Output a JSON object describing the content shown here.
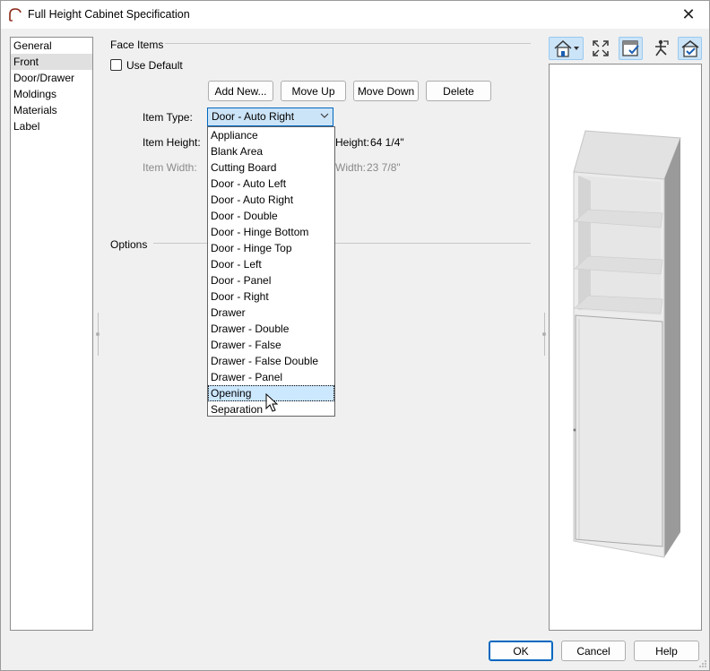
{
  "window": {
    "title": "Full Height Cabinet Specification",
    "close_glyph": "✕"
  },
  "nav": {
    "items": [
      {
        "label": "General",
        "selected": false
      },
      {
        "label": "Front",
        "selected": true
      },
      {
        "label": "Door/Drawer",
        "selected": false
      },
      {
        "label": "Moldings",
        "selected": false
      },
      {
        "label": "Materials",
        "selected": false
      },
      {
        "label": "Label",
        "selected": false
      }
    ]
  },
  "face_items": {
    "group_label": "Face Items",
    "use_default_label": "Use Default",
    "use_default_checked": false,
    "buttons": {
      "add_new": "Add New...",
      "move_up": "Move Up",
      "move_down": "Move Down",
      "delete": "Delete"
    },
    "item_type_label": "Item Type:",
    "item_type_value": "Door - Auto Right",
    "item_height_label": "Item Height:",
    "height_value_label": "Height:",
    "height_value": "64 1/4\"",
    "item_width_label": "Item Width:",
    "width_value_label": "Width:",
    "width_value": "23 7/8\""
  },
  "item_type_options": [
    "Appliance",
    "Blank Area",
    "Cutting Board",
    "Door - Auto Left",
    "Door - Auto Right",
    "Door - Double",
    "Door - Hinge Bottom",
    "Door - Hinge Top",
    "Door - Left",
    "Door - Panel",
    "Door - Right",
    "Drawer",
    "Drawer - Double",
    "Drawer - False",
    "Drawer - False Double",
    "Drawer - Panel",
    "Opening",
    "Separation"
  ],
  "highlighted_option": "Opening",
  "options_group": {
    "label": "Options"
  },
  "preview_toolbar": {
    "icons": [
      "view-type-icon",
      "fill-window-icon",
      "layer-toggle-icon",
      "camera-control-icon",
      "render-toggle-icon"
    ]
  },
  "footer": {
    "ok": "OK",
    "cancel": "Cancel",
    "help": "Help"
  },
  "colors": {
    "accent": "#0067c0",
    "selection": "#cce8ff"
  }
}
